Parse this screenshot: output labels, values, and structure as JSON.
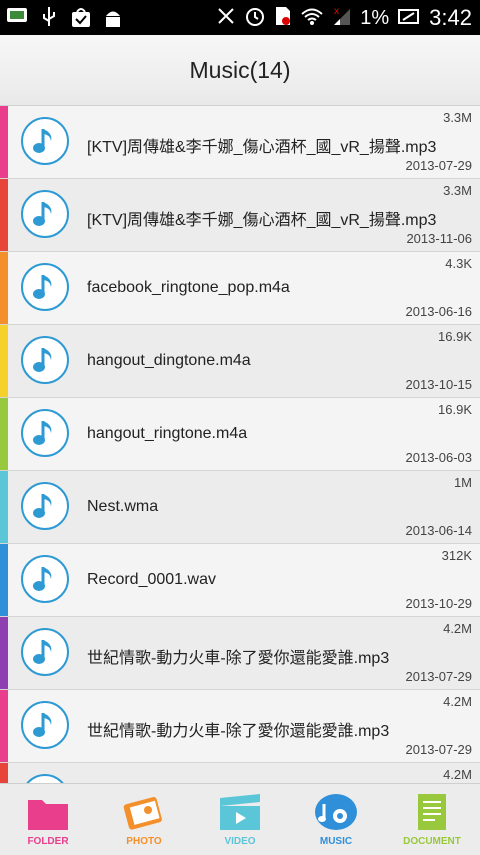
{
  "status_bar": {
    "battery_percent": "1%",
    "time": "3:42",
    "icons": [
      "screen-icon",
      "usb-icon",
      "bag-check-icon",
      "android-icon",
      "mute-icon",
      "alarm-icon",
      "sim-icon",
      "wifi-icon",
      "signal-icon",
      "battery-icon"
    ]
  },
  "header": {
    "title": "Music(14)"
  },
  "files": [
    {
      "name": "[KTV]周傳雄&李千娜_傷心酒杯_國_vR_揚聲.mp3",
      "size": "3.3M",
      "date": "2013-07-29",
      "stripe_color": "#e83e8c"
    },
    {
      "name": "[KTV]周傳雄&李千娜_傷心酒杯_國_vR_揚聲.mp3",
      "size": "3.3M",
      "date": "2013-11-06",
      "stripe_color": "#e8443a"
    },
    {
      "name": "facebook_ringtone_pop.m4a",
      "size": "4.3K",
      "date": "2013-06-16",
      "stripe_color": "#f4902b"
    },
    {
      "name": "hangout_dingtone.m4a",
      "size": "16.9K",
      "date": "2013-10-15",
      "stripe_color": "#f6d02b"
    },
    {
      "name": "hangout_ringtone.m4a",
      "size": "16.9K",
      "date": "2013-06-03",
      "stripe_color": "#98c93c"
    },
    {
      "name": "Nest.wma",
      "size": "1M",
      "date": "2013-06-14",
      "stripe_color": "#5bc6d8"
    },
    {
      "name": "Record_0001.wav",
      "size": "312K",
      "date": "2013-10-29",
      "stripe_color": "#2f8fd8"
    },
    {
      "name": "世紀情歌-動力火車-除了愛你還能愛誰.mp3",
      "size": "4.2M",
      "date": "2013-07-29",
      "stripe_color": "#8e3fb0"
    },
    {
      "name": "世紀情歌-動力火車-除了愛你還能愛誰.mp3",
      "size": "4.2M",
      "date": "2013-07-29",
      "stripe_color": "#e83e8c"
    },
    {
      "name": "",
      "size": "4.2M",
      "date": "",
      "stripe_color": "#e8443a"
    }
  ],
  "tabs": [
    {
      "label": "FOLDER",
      "color": "#e83e8c",
      "icon": "folder-icon"
    },
    {
      "label": "PHOTO",
      "color": "#f4902b",
      "icon": "photo-icon"
    },
    {
      "label": "VIDEO",
      "color": "#5bc6d8",
      "icon": "video-icon"
    },
    {
      "label": "MUSIC",
      "color": "#2f8fd8",
      "icon": "music-icon",
      "active": true
    },
    {
      "label": "DOCUMENT",
      "color": "#98c93c",
      "icon": "document-icon"
    }
  ]
}
